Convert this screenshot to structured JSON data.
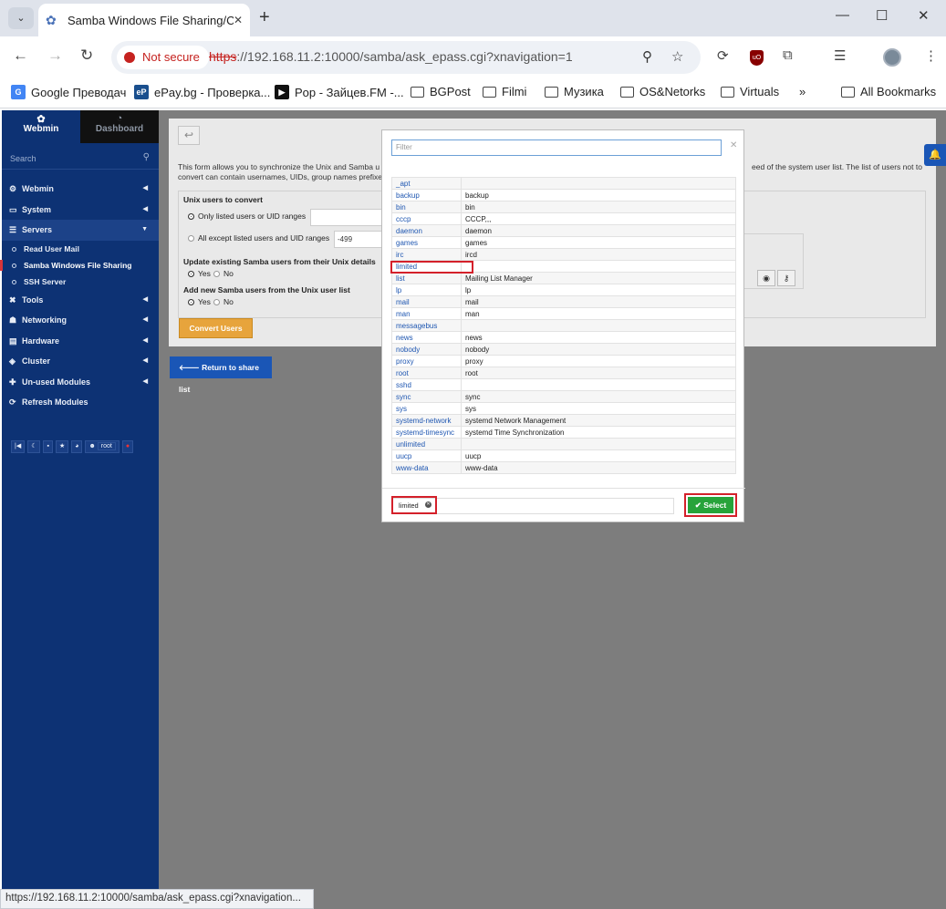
{
  "browser": {
    "tab_title": "Samba Windows File Sharing/C",
    "url_scheme": "https",
    "url_rest": "://192.168.11.2:10000/samba/ask_epass.cgi?xnavigation=1",
    "security_label": "Not secure",
    "status_url": "https://192.168.11.2:10000/samba/ask_epass.cgi?xnavigation..."
  },
  "bookmarks": [
    "Google Преводач",
    "ePay.bg - Проверка...",
    "Pop - Зайцев.FM -...",
    "BGPost",
    "Filmi",
    "Музика",
    "OS&Netorks",
    "Virtuals",
    "All Bookmarks"
  ],
  "sidebar": {
    "tab_webmin": "Webmin",
    "tab_dashboard": "Dashboard",
    "search_placeholder": "Search",
    "items": [
      {
        "label": "Webmin",
        "icon": "gear-icon"
      },
      {
        "label": "System",
        "icon": "monitor-icon"
      },
      {
        "label": "Servers",
        "icon": "list-icon"
      }
    ],
    "subitems": [
      "Read User Mail",
      "Samba Windows File Sharing",
      "SSH Server"
    ],
    "items2": [
      {
        "label": "Tools",
        "icon": "wrench-icon"
      },
      {
        "label": "Networking",
        "icon": "network-icon"
      },
      {
        "label": "Hardware",
        "icon": "hdd-icon"
      },
      {
        "label": "Cluster",
        "icon": "cluster-icon"
      },
      {
        "label": "Un-used Modules",
        "icon": "puzzle-icon"
      },
      {
        "label": "Refresh Modules",
        "icon": "refresh-icon"
      }
    ],
    "user": "root"
  },
  "form": {
    "desc_line1": "This form allows you to synchronize the Unix and Samba u",
    "desc_line2": "convert can contain usernames, UIDs, group names prefixe",
    "desc_right": "eed of the system user list. The list of users not to",
    "unix_users_label": "Unix users to convert",
    "opt_only": "Only listed users or UID ranges",
    "opt_except": "All except listed users and UID ranges",
    "except_value": "-499",
    "update_label": "Update existing Samba users from their Unix details",
    "add_label": "Add new Samba users from the Unix user list",
    "yes": "Yes",
    "no": "No",
    "convert_button": "Convert Users",
    "return_button": "Return to share list"
  },
  "modal": {
    "filter_placeholder": "Filter",
    "select_button": "Select",
    "selected_tag": "limited",
    "rows": [
      {
        "user": "_apt",
        "desc": ""
      },
      {
        "user": "backup",
        "desc": "backup"
      },
      {
        "user": "bin",
        "desc": "bin"
      },
      {
        "user": "cccp",
        "desc": "CCCP,,,"
      },
      {
        "user": "daemon",
        "desc": "daemon"
      },
      {
        "user": "games",
        "desc": "games"
      },
      {
        "user": "irc",
        "desc": "ircd"
      },
      {
        "user": "limited",
        "desc": ""
      },
      {
        "user": "list",
        "desc": "Mailing List Manager"
      },
      {
        "user": "lp",
        "desc": "lp"
      },
      {
        "user": "mail",
        "desc": "mail"
      },
      {
        "user": "man",
        "desc": "man"
      },
      {
        "user": "messagebus",
        "desc": ""
      },
      {
        "user": "news",
        "desc": "news"
      },
      {
        "user": "nobody",
        "desc": "nobody"
      },
      {
        "user": "proxy",
        "desc": "proxy"
      },
      {
        "user": "root",
        "desc": "root"
      },
      {
        "user": "sshd",
        "desc": ""
      },
      {
        "user": "sync",
        "desc": "sync"
      },
      {
        "user": "sys",
        "desc": "sys"
      },
      {
        "user": "systemd-network",
        "desc": "systemd Network Management"
      },
      {
        "user": "systemd-timesync",
        "desc": "systemd Time Synchronization"
      },
      {
        "user": "unlimited",
        "desc": ""
      },
      {
        "user": "uucp",
        "desc": "uucp"
      },
      {
        "user": "www-data",
        "desc": "www-data"
      }
    ]
  }
}
